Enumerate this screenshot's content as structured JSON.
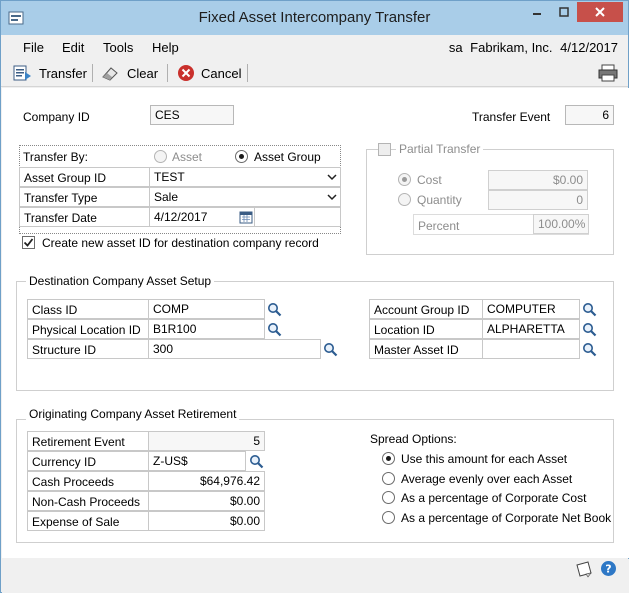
{
  "window": {
    "title": "Fixed Asset Intercompany Transfer"
  },
  "menu": {
    "items": [
      "File",
      "Edit",
      "Tools",
      "Help"
    ],
    "user": "sa",
    "company": "Fabrikam, Inc.",
    "date": "4/12/2017"
  },
  "toolbar": {
    "transfer": "Transfer",
    "clear": "Clear",
    "cancel": "Cancel"
  },
  "header": {
    "company_id_label": "Company ID",
    "company_id": "CES",
    "transfer_event_label": "Transfer Event",
    "transfer_event": "6"
  },
  "transfer": {
    "transfer_by_label": "Transfer By:",
    "asset_label": "Asset",
    "asset_group_label": "Asset Group",
    "asset_group_id_label": "Asset Group ID",
    "asset_group_id": "TEST",
    "transfer_type_label": "Transfer Type",
    "transfer_type": "Sale",
    "transfer_date_label": "Transfer Date",
    "transfer_date": "4/12/2017",
    "create_new_label": "Create new asset ID for destination company record"
  },
  "partial": {
    "title": "Partial Transfer",
    "cost_label": "Cost",
    "cost": "$0.00",
    "quantity_label": "Quantity",
    "quantity": "0",
    "percent_label": "Percent",
    "percent": "100.00%"
  },
  "destination": {
    "title": "Destination Company Asset Setup",
    "class_id_label": "Class ID",
    "class_id": "COMP",
    "physical_location_label": "Physical Location ID",
    "physical_location": "B1R100",
    "structure_id_label": "Structure ID",
    "structure_id": "300",
    "account_group_label": "Account Group ID",
    "account_group": "COMPUTER",
    "location_id_label": "Location ID",
    "location_id": "ALPHARETTA",
    "master_asset_label": "Master Asset ID",
    "master_asset": ""
  },
  "retirement": {
    "title": "Originating Company Asset Retirement",
    "event_label": "Retirement Event",
    "event": "5",
    "currency_label": "Currency ID",
    "currency": "Z-US$",
    "cash_label": "Cash Proceeds",
    "cash": "$64,976.42",
    "noncash_label": "Non-Cash Proceeds",
    "noncash": "$0.00",
    "expense_label": "Expense of Sale",
    "expense": "$0.00"
  },
  "spread": {
    "title": "Spread Options:",
    "options": [
      "Use this amount for each Asset",
      "Average evenly over each Asset",
      "As a percentage of Corporate Cost",
      "As a percentage of Corporate Net Book"
    ]
  }
}
